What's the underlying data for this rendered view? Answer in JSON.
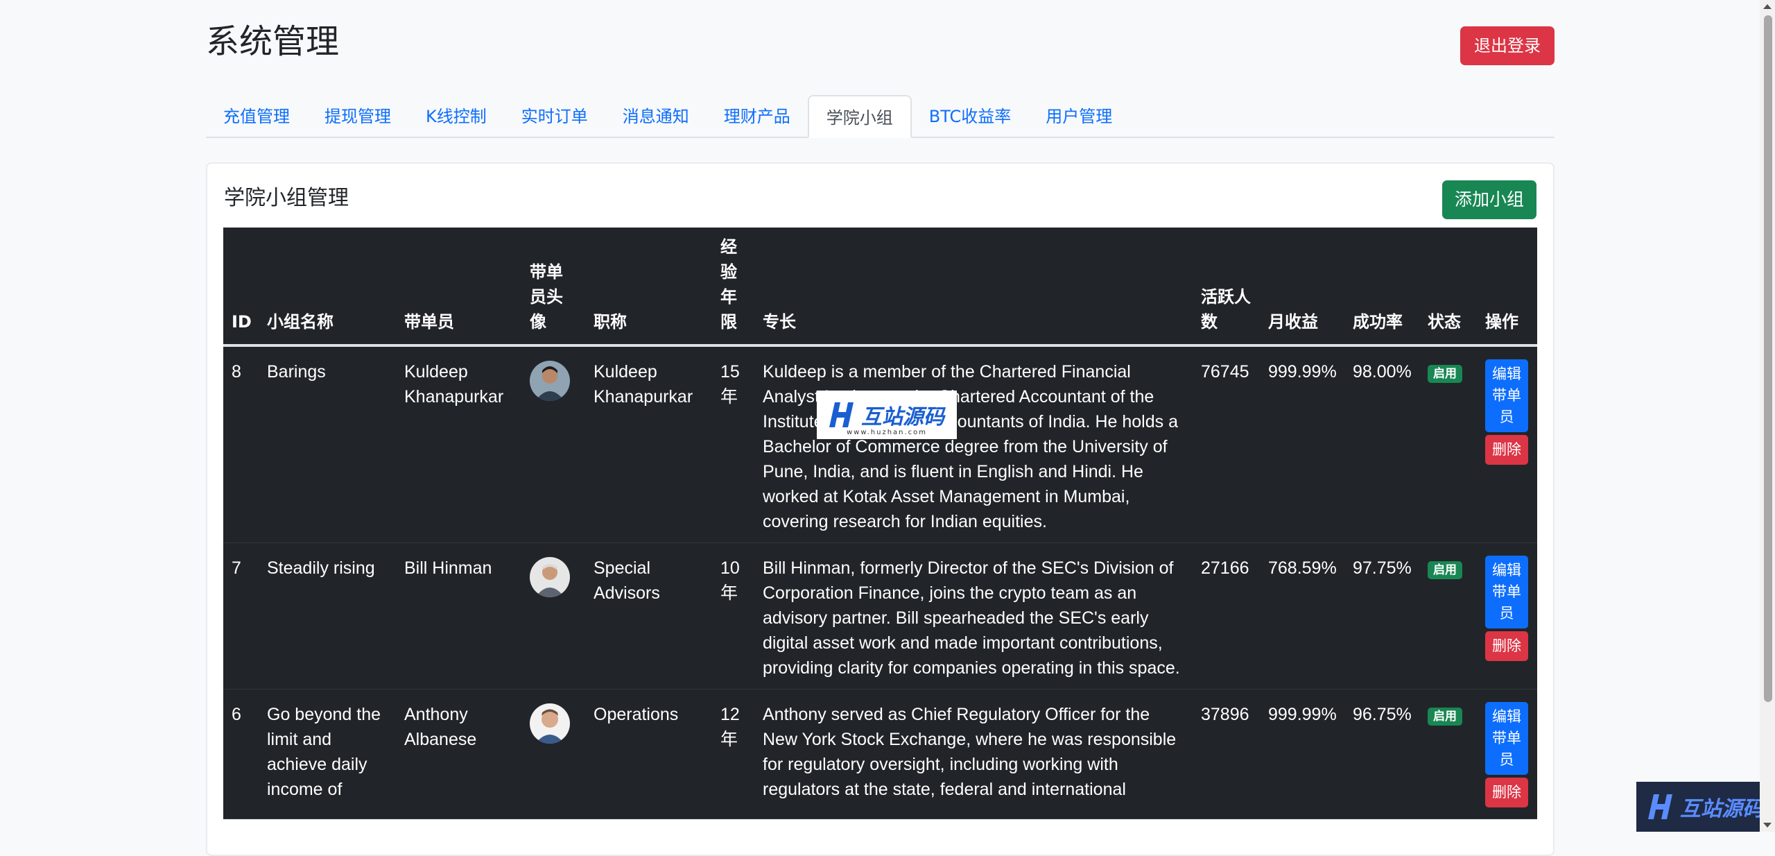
{
  "header": {
    "title": "系统管理",
    "logout_label": "退出登录"
  },
  "tabs": [
    {
      "label": "充值管理",
      "active": false
    },
    {
      "label": "提现管理",
      "active": false
    },
    {
      "label": "K线控制",
      "active": false
    },
    {
      "label": "实时订单",
      "active": false
    },
    {
      "label": "消息通知",
      "active": false
    },
    {
      "label": "理财产品",
      "active": false
    },
    {
      "label": "学院小组",
      "active": true
    },
    {
      "label": "BTC收益率",
      "active": false
    },
    {
      "label": "用户管理",
      "active": false
    }
  ],
  "card": {
    "title": "学院小组管理",
    "add_label": "添加小组"
  },
  "table": {
    "headers": {
      "id": "ID",
      "name": "小组名称",
      "leader": "带单员",
      "avatar": "带单员头像",
      "title": "职称",
      "years": "经验年限",
      "specialty": "专长",
      "active": "活跃人数",
      "monthly": "月收益",
      "success": "成功率",
      "status": "状态",
      "actions": "操作"
    },
    "rows": [
      {
        "id": "8",
        "name": "Barings",
        "leader": "Kuldeep Khanapurkar",
        "title": "Kuldeep Khanapurkar",
        "years": "15年",
        "specialty": "Kuldeep is a member of the Chartered Financial Analyst Institute and a Chartered Accountant of the Institute of Chartered Accountants of India. He holds a Bachelor of Commerce degree from the University of Pune, India, and is fluent in English and Hindi. He worked at Kotak Asset Management in Mumbai, covering research for Indian equities.",
        "active": "76745",
        "monthly": "999.99%",
        "success": "98.00%",
        "status": "启用",
        "edit_label": "编辑带单员",
        "delete_label": "删除"
      },
      {
        "id": "7",
        "name": "Steadily rising",
        "leader": "Bill Hinman",
        "title": "Special Advisors",
        "years": "10年",
        "specialty": "Bill Hinman, formerly Director of the SEC's Division of Corporation Finance, joins the crypto team as an advisory partner. Bill spearheaded the SEC's early digital asset work and made important contributions, providing clarity for companies operating in this space.",
        "active": "27166",
        "monthly": "768.59%",
        "success": "97.75%",
        "status": "启用",
        "edit_label": "编辑带单员",
        "delete_label": "删除"
      },
      {
        "id": "6",
        "name": "Go beyond the limit and achieve daily income of",
        "leader": "Anthony Albanese",
        "title": "Operations",
        "years": "12年",
        "specialty": "Anthony served as Chief Regulatory Officer for the New York Stock Exchange, where he was responsible for regulatory oversight, including working with regulators at the state, federal and international",
        "active": "37896",
        "monthly": "999.99%",
        "success": "96.75%",
        "status": "启用",
        "edit_label": "编辑带单员",
        "delete_label": "删除"
      }
    ]
  },
  "watermark": {
    "text": "互站源码",
    "sub": "www.huzhan.com"
  },
  "colors": {
    "primary": "#0d6efd",
    "danger": "#dc3545",
    "success": "#198754",
    "table_dark": "#212529"
  }
}
